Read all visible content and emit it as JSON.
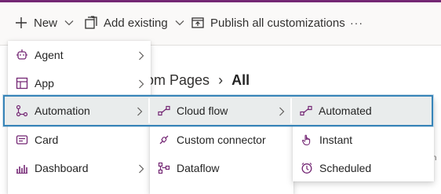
{
  "toolbar": {
    "new_label": "New",
    "add_existing_label": "Add existing",
    "publish_label": "Publish all customizations",
    "more_label": "···"
  },
  "background": {
    "title_prefix": "om Pages",
    "title_sep": "›",
    "title_current": "All",
    "fragment": "m"
  },
  "menu_level1": [
    {
      "label": "Agent",
      "icon": "agent-icon",
      "submenu": true
    },
    {
      "label": "App",
      "icon": "app-icon",
      "submenu": true
    },
    {
      "label": "Automation",
      "icon": "automation-icon",
      "submenu": true,
      "selected": true
    },
    {
      "label": "Card",
      "icon": "card-icon",
      "submenu": false
    },
    {
      "label": "Dashboard",
      "icon": "dashboard-icon",
      "submenu": true
    }
  ],
  "menu_level2": [
    {
      "label": "Cloud flow",
      "icon": "cloud-flow-icon",
      "submenu": true,
      "selected": true
    },
    {
      "label": "Custom connector",
      "icon": "custom-connector-icon",
      "submenu": false
    },
    {
      "label": "Dataflow",
      "icon": "dataflow-icon",
      "submenu": false
    }
  ],
  "menu_level3": [
    {
      "label": "Automated",
      "icon": "automated-flow-icon",
      "selected": true
    },
    {
      "label": "Instant",
      "icon": "instant-flow-icon"
    },
    {
      "label": "Scheduled",
      "icon": "scheduled-flow-icon"
    }
  ],
  "colors": {
    "accent": "#742774",
    "highlight_border": "#3784b8",
    "highlight_fill": "#e9ecec",
    "icon": "#742774"
  }
}
